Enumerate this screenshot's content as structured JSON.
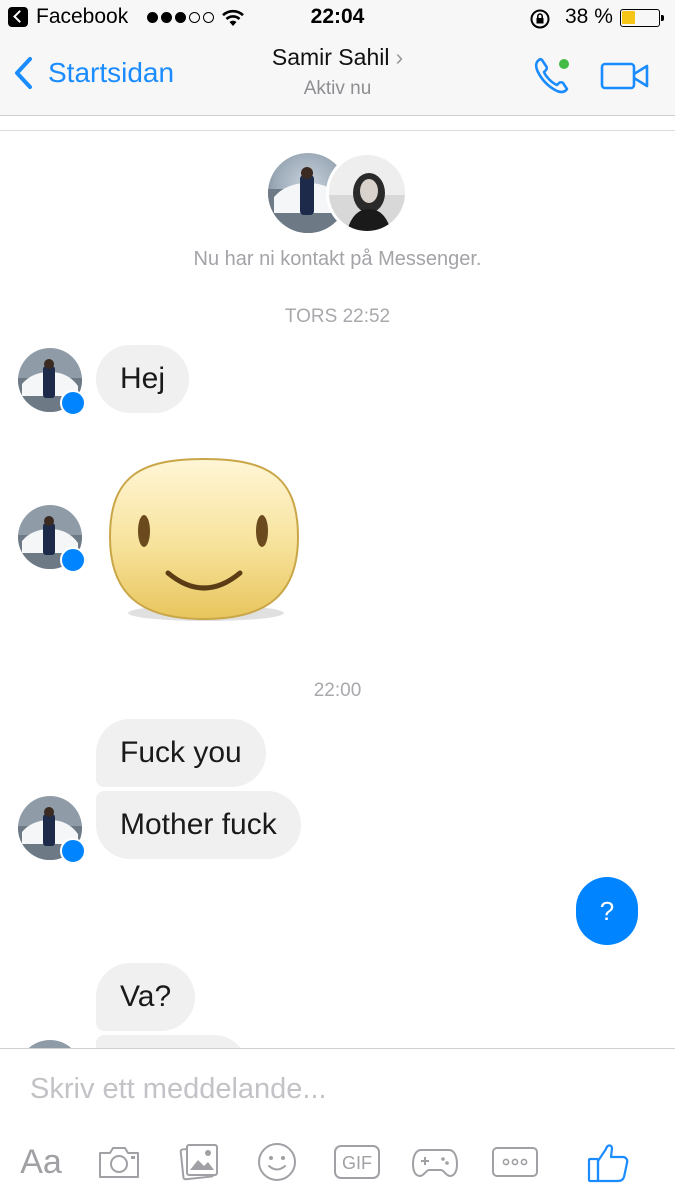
{
  "status_bar": {
    "carrier": "Facebook",
    "signal_dots_filled": 3,
    "signal_dots_total": 5,
    "time": "22:04",
    "battery_percent": "38 %",
    "battery_level": 0.38,
    "battery_color": "#f5c518"
  },
  "nav": {
    "back_label": "Startsidan",
    "title": "Samir Sahil",
    "subtitle": "Aktiv nu",
    "accent_color": "#1a8cff",
    "online_color": "#44bb44"
  },
  "conversation": {
    "contact_notice": "Nu har ni kontakt på Messenger.",
    "timestamp_1": "TORS 22:52",
    "timestamp_2": "22:00",
    "messages": [
      {
        "sender": "them",
        "type": "text",
        "text": "Hej"
      },
      {
        "sender": "them",
        "type": "sticker",
        "sticker": "smiley-face"
      },
      {
        "sender": "them",
        "type": "text",
        "text": "Fuck you"
      },
      {
        "sender": "them",
        "type": "text",
        "text": "Mother fuck"
      },
      {
        "sender": "me",
        "type": "text",
        "text": "?"
      },
      {
        "sender": "them",
        "type": "text",
        "text": "Va?"
      }
    ]
  },
  "composer": {
    "placeholder": "Skriv ett meddelande...",
    "aa_label": "Aa",
    "gif_label": "GIF",
    "tools": [
      "aa-icon",
      "camera-icon",
      "gallery-icon",
      "emoji-icon",
      "gif-icon",
      "game-controller-icon",
      "more-icon",
      "thumbs-up-icon"
    ]
  }
}
